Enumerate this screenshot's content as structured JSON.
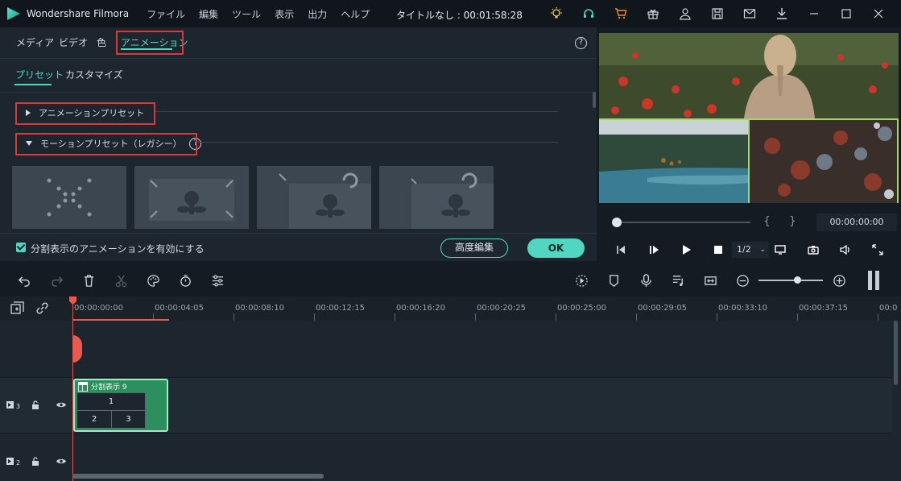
{
  "app": {
    "name": "Wondershare Filmora",
    "menu": [
      "ファイル",
      "編集",
      "ツール",
      "表示",
      "出力",
      "ヘルプ"
    ],
    "title": "タイトルなし : 00:01:58:28",
    "top_icons": [
      "lightbulb-icon",
      "headset-icon",
      "cart-icon",
      "gift-icon",
      "user-icon",
      "save-icon",
      "mail-icon",
      "download-icon",
      "minimize-icon",
      "maximize-icon",
      "close-icon"
    ]
  },
  "panel": {
    "tabs": [
      "メディア",
      "ビデオ",
      "色",
      "アニメーション"
    ],
    "active_tab": "アニメーション",
    "help": "?",
    "subtabs": [
      "プリセット",
      "カスタマイズ"
    ],
    "active_subtab": "プリセット",
    "section_animation_preset": "アニメーションプリセット",
    "section_motion_preset": "モーションプリセット（レガシー）",
    "checkbox_label": "分割表示のアニメーションを有効にする",
    "advanced_button": "高度編集",
    "ok_button": "OK"
  },
  "preview": {
    "timecode": "00:00:00:00",
    "brace_left": "{",
    "brace_right": "}",
    "ratio": "1/2"
  },
  "timeline": {
    "ruler_labels": [
      "00:00:00:00",
      "00:00:04:05",
      "00:00:08:10",
      "00:00:12:15",
      "00:00:16:20",
      "00:00:20:25",
      "00:00:25:00",
      "00:00:29:05",
      "00:00:33:10",
      "00:00:37:15",
      "00:0"
    ],
    "tracks": [
      {
        "label": "3",
        "icon": "video-track-icon"
      },
      {
        "label": "2",
        "icon": "video-track-icon"
      }
    ],
    "clip": {
      "title": "分割表示 9",
      "cells": [
        "1",
        "2",
        "3"
      ]
    }
  },
  "colors": {
    "accent": "#51d6c2",
    "highlight_red": "#d83a3a",
    "playhead": "#e85a4f",
    "clip_green": "#2e8f5e"
  }
}
